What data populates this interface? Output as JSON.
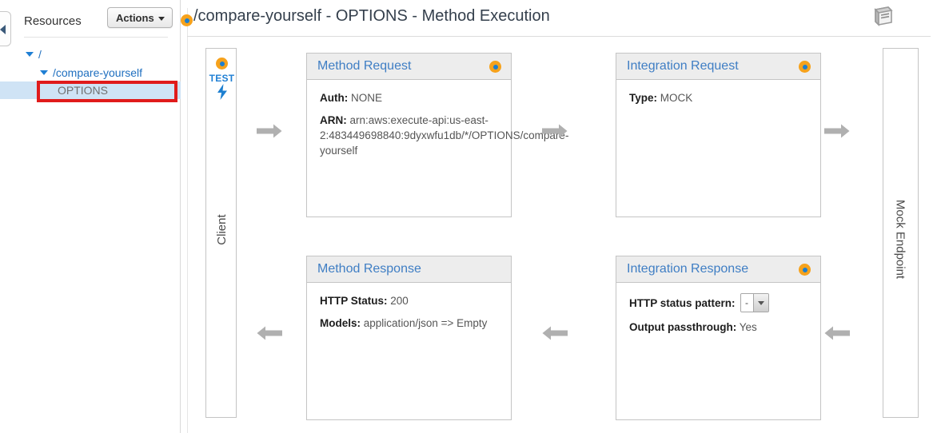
{
  "sidebar": {
    "collapse_icon": "chevron-left-icon",
    "resources_label": "Resources",
    "actions_label": "Actions",
    "tree": {
      "root_label": "/",
      "resource_label": "/compare-yourself",
      "method_label": "OPTIONS"
    },
    "highlight_color": "#e01b1b"
  },
  "header": {
    "title": "/compare-yourself - OPTIONS - Method Execution",
    "docs_icon": "book-icon",
    "status_dot_icon": "orange-target-dot-icon"
  },
  "flow": {
    "client_column": {
      "label": "Client",
      "test_label": "TEST",
      "test_icon": "lightning-bolt-icon",
      "dot_icon": "orange-target-dot-icon"
    },
    "endpoint_column": {
      "label": "Mock Endpoint"
    },
    "arrow_right_icon": "arrow-right-icon",
    "arrow_left_icon": "arrow-left-icon",
    "cards": {
      "method_request": {
        "title": "Method Request",
        "auth_label": "Auth:",
        "auth_value": "NONE",
        "arn_label": "ARN:",
        "arn_value": "arn:aws:execute-api:us-east-2:483449698840:9dyxwfu1db/*/OPTIONS/compare-yourself"
      },
      "integration_request": {
        "title": "Integration Request",
        "type_label": "Type:",
        "type_value": "MOCK"
      },
      "method_response": {
        "title": "Method Response",
        "status_label": "HTTP Status:",
        "status_value": "200",
        "models_label": "Models:",
        "models_value": "application/json => Empty"
      },
      "integration_response": {
        "title": "Integration Response",
        "pattern_label": "HTTP status pattern:",
        "pattern_value": "-",
        "pattern_dropdown_icon": "chevron-down-icon",
        "passthrough_label": "Output passthrough:",
        "passthrough_value": "Yes"
      }
    }
  },
  "colors": {
    "accent_orange": "#f6a21c",
    "accent_blue": "#1d7fd0",
    "title_link_blue": "#3f7ec4",
    "selection_blue": "#cfe3f5",
    "annotation_red": "#e01b1b"
  }
}
